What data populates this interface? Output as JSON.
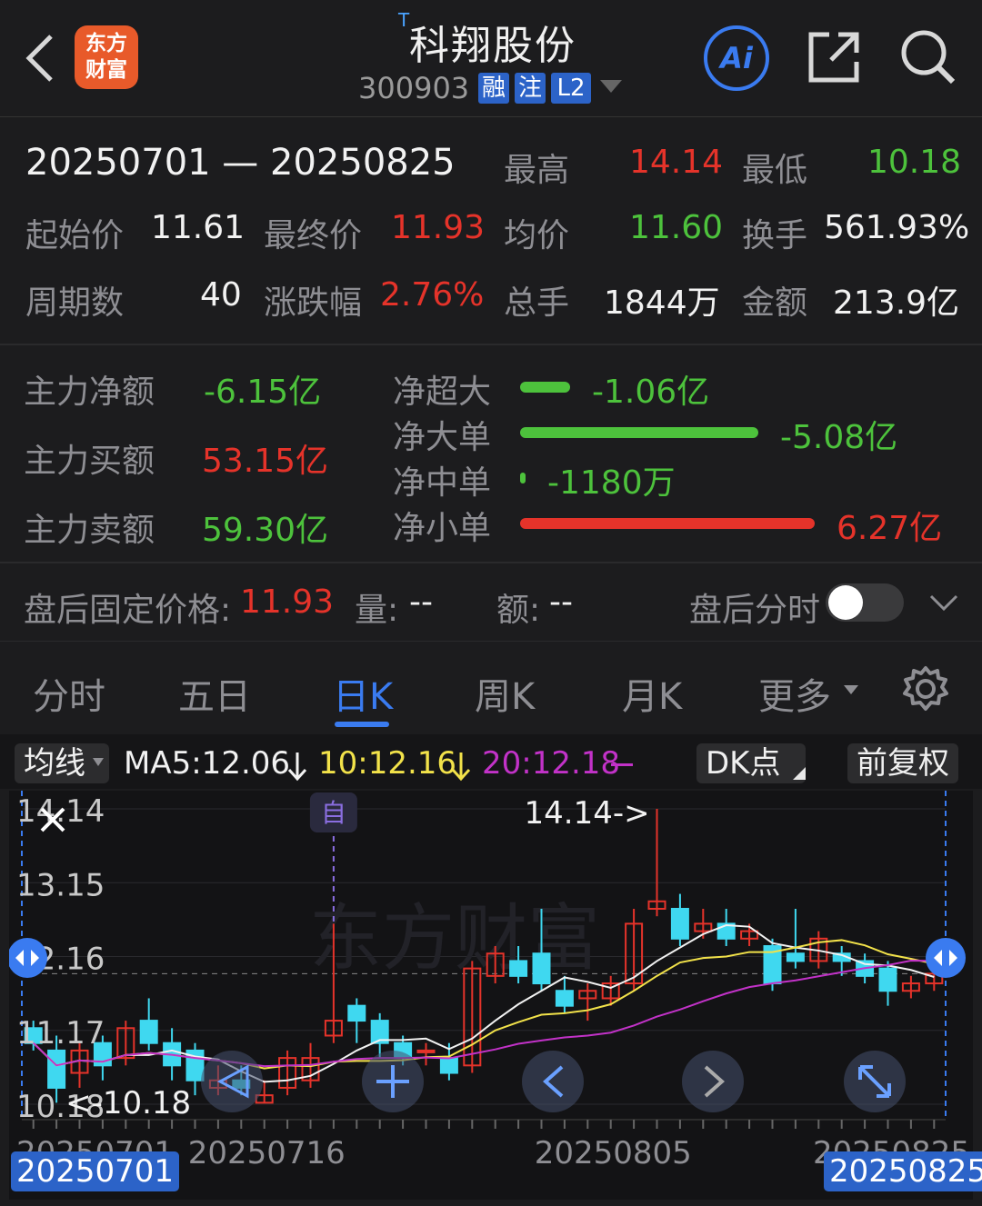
{
  "header": {
    "back_icon": "chevron-left-icon",
    "logo_line1": "东方",
    "logo_line2": "财富",
    "t_mark": "T",
    "stock_name": "科翔股份",
    "stock_code": "300903",
    "tags": [
      "融",
      "注",
      "L2"
    ],
    "ai_label": "Ai",
    "share_icon": "share-icon",
    "search_icon": "search-icon"
  },
  "summary": {
    "date_range": "20250701 — 20250825",
    "high_label": "最高",
    "high_value": "14.14",
    "low_label": "最低",
    "low_value": "10.18",
    "open_label": "起始价",
    "open_value": "11.61",
    "close_label": "最终价",
    "close_value": "11.93",
    "avg_label": "均价",
    "avg_value": "11.60",
    "turnover_label": "换手",
    "turnover_value": "561.93%",
    "periods_label": "周期数",
    "periods_value": "40",
    "change_label": "涨跌幅",
    "change_value": "2.76%",
    "volume_label": "总手",
    "volume_value": "1844万",
    "amount_label": "金额",
    "amount_value": "213.9亿"
  },
  "flow": {
    "main_net_label": "主力净额",
    "main_net_value": "-6.15亿",
    "main_buy_label": "主力买额",
    "main_buy_value": "53.15亿",
    "main_sell_label": "主力卖额",
    "main_sell_value": "59.30亿",
    "rows": [
      {
        "label": "净超大",
        "value": "-1.06亿",
        "fraction": 0.17,
        "color": "#4dc23c"
      },
      {
        "label": "净大单",
        "value": "-5.08亿",
        "fraction": 0.81,
        "color": "#4dc23c"
      },
      {
        "label": "净中单",
        "value": "-1180万",
        "fraction": 0.02,
        "color": "#4dc23c"
      },
      {
        "label": "净小单",
        "value": "6.27亿",
        "fraction": 1.0,
        "color": "#e5332a"
      }
    ]
  },
  "after_hours": {
    "fixed_price_label": "盘后固定价格:",
    "fixed_price_value": "11.93",
    "volume_label": "量:",
    "volume_value": "--",
    "amount_label": "额:",
    "amount_value": "--",
    "timeshare_label": "盘后分时",
    "toggle_on": false
  },
  "tabs": [
    "分时",
    "五日",
    "日K",
    "周K",
    "月K",
    "更多"
  ],
  "active_tab": "日K",
  "chart_toolbar": {
    "ma_selector": "均线",
    "ma5": "MA5:12.06",
    "ma10": "10:12.16",
    "ma20": "20:12.18",
    "dk_button": "DK点",
    "adjust_button": "前复权"
  },
  "chart_data": {
    "type": "candlestick",
    "y_ticks": [
      "14.14",
      "13.15",
      "12.16",
      "11.17",
      "10.18"
    ],
    "x_ticks": [
      "20250701",
      "20250716",
      "20250805",
      "20250825"
    ],
    "max_annotation": "14.14->",
    "min_annotation": "<-10.18",
    "self_marker": "自",
    "watermark": "东方财富",
    "start_date_badge": "20250701",
    "end_date_badge": "20250825",
    "ylim": [
      10.18,
      14.14
    ],
    "candles": [
      {
        "o": 11.2,
        "c": 11.0,
        "h": 11.3,
        "l": 10.9
      },
      {
        "o": 10.9,
        "c": 10.4,
        "h": 11.1,
        "l": 10.2
      },
      {
        "o": 10.6,
        "c": 10.9,
        "h": 11.0,
        "l": 10.4
      },
      {
        "o": 11.0,
        "c": 10.7,
        "h": 11.1,
        "l": 10.5
      },
      {
        "o": 10.8,
        "c": 11.2,
        "h": 11.3,
        "l": 10.7
      },
      {
        "o": 11.3,
        "c": 11.0,
        "h": 11.6,
        "l": 10.9
      },
      {
        "o": 11.0,
        "c": 10.7,
        "h": 11.2,
        "l": 10.5
      },
      {
        "o": 10.9,
        "c": 10.5,
        "h": 11.0,
        "l": 10.3
      },
      {
        "o": 10.4,
        "c": 10.5,
        "h": 10.7,
        "l": 10.3
      },
      {
        "o": 10.5,
        "c": 10.4,
        "h": 10.7,
        "l": 10.3
      },
      {
        "o": 10.2,
        "c": 10.3,
        "h": 10.5,
        "l": 10.2
      },
      {
        "o": 10.4,
        "c": 10.8,
        "h": 10.9,
        "l": 10.3
      },
      {
        "o": 10.5,
        "c": 10.8,
        "h": 11.0,
        "l": 10.4
      },
      {
        "o": 11.1,
        "c": 11.3,
        "h": 12.6,
        "l": 11.0
      },
      {
        "o": 11.5,
        "c": 11.3,
        "h": 11.6,
        "l": 11.0
      },
      {
        "o": 11.3,
        "c": 11.0,
        "h": 11.4,
        "l": 10.8
      },
      {
        "o": 11.0,
        "c": 10.8,
        "h": 11.1,
        "l": 10.7
      },
      {
        "o": 10.9,
        "c": 10.9,
        "h": 11.0,
        "l": 10.7
      },
      {
        "o": 10.8,
        "c": 10.6,
        "h": 11.0,
        "l": 10.5
      },
      {
        "o": 10.7,
        "c": 12.0,
        "h": 12.1,
        "l": 10.6
      },
      {
        "o": 11.9,
        "c": 12.2,
        "h": 12.3,
        "l": 11.8
      },
      {
        "o": 12.1,
        "c": 11.9,
        "h": 12.3,
        "l": 11.8
      },
      {
        "o": 12.2,
        "c": 11.8,
        "h": 12.8,
        "l": 11.7
      },
      {
        "o": 11.7,
        "c": 11.5,
        "h": 11.9,
        "l": 11.4
      },
      {
        "o": 11.6,
        "c": 11.7,
        "h": 11.8,
        "l": 11.3
      },
      {
        "o": 11.6,
        "c": 11.8,
        "h": 11.9,
        "l": 11.5
      },
      {
        "o": 11.8,
        "c": 12.6,
        "h": 12.8,
        "l": 11.7
      },
      {
        "o": 12.8,
        "c": 12.9,
        "h": 14.14,
        "l": 12.7
      },
      {
        "o": 12.8,
        "c": 12.4,
        "h": 13.0,
        "l": 12.3
      },
      {
        "o": 12.5,
        "c": 12.6,
        "h": 12.8,
        "l": 12.4
      },
      {
        "o": 12.6,
        "c": 12.4,
        "h": 12.8,
        "l": 12.3
      },
      {
        "o": 12.4,
        "c": 12.5,
        "h": 12.6,
        "l": 12.3
      },
      {
        "o": 12.3,
        "c": 11.8,
        "h": 12.4,
        "l": 11.7
      },
      {
        "o": 12.2,
        "c": 12.1,
        "h": 12.8,
        "l": 12.0
      },
      {
        "o": 12.1,
        "c": 12.4,
        "h": 12.5,
        "l": 12.0
      },
      {
        "o": 12.2,
        "c": 12.1,
        "h": 12.3,
        "l": 11.9
      },
      {
        "o": 12.1,
        "c": 11.9,
        "h": 12.2,
        "l": 11.8
      },
      {
        "o": 12.0,
        "c": 11.7,
        "h": 12.1,
        "l": 11.5
      },
      {
        "o": 11.7,
        "c": 11.8,
        "h": 11.9,
        "l": 11.6
      },
      {
        "o": 11.8,
        "c": 11.93,
        "h": 12.0,
        "l": 11.7
      }
    ]
  }
}
